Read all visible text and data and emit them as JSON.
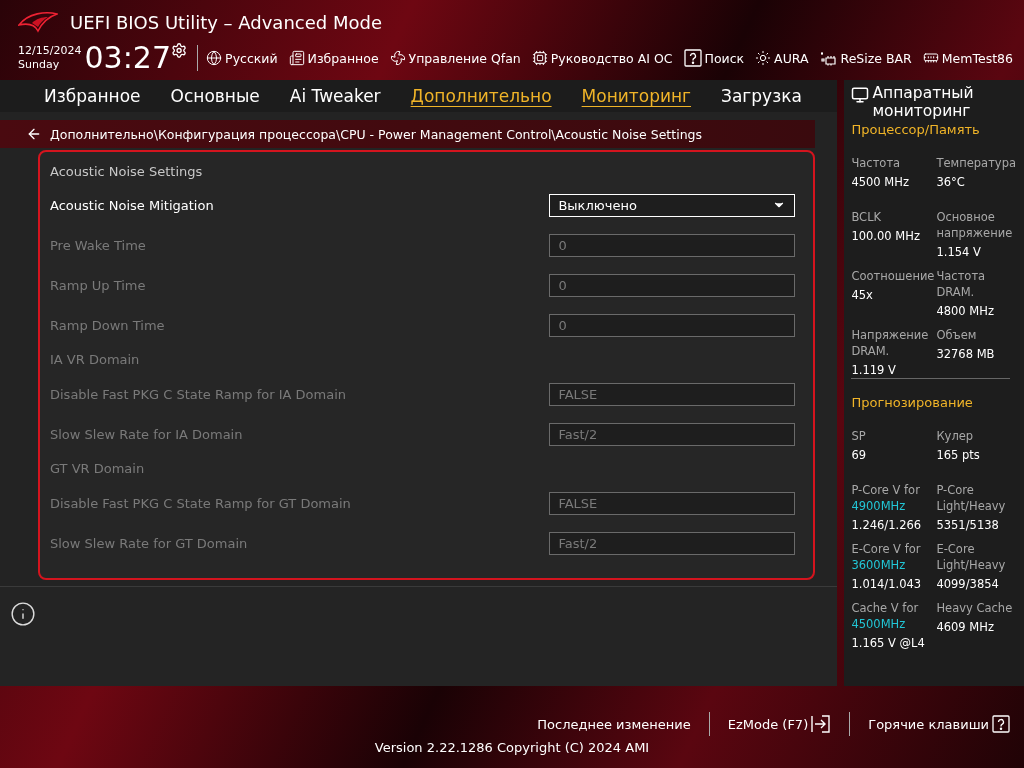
{
  "header": {
    "title": "UEFI BIOS Utility – Advanced Mode",
    "date": "12/15/2024",
    "day": "Sunday",
    "time": "03:27",
    "toolbar": [
      {
        "label": "Русский"
      },
      {
        "label": "Избранное"
      },
      {
        "label": "Управление Qfan"
      },
      {
        "label": "Руководство AI OC"
      },
      {
        "label": "Поиск"
      },
      {
        "label": "AURA"
      },
      {
        "label": "ReSize BAR"
      },
      {
        "label": "MemTest86"
      }
    ]
  },
  "tabs": [
    {
      "label": "Избранное",
      "highlighted": false
    },
    {
      "label": "Основные",
      "highlighted": false
    },
    {
      "label": "Ai Tweaker",
      "highlighted": false
    },
    {
      "label": "Дополнительно",
      "highlighted": true
    },
    {
      "label": "Мониторинг",
      "highlighted": true
    },
    {
      "label": "Загрузка",
      "highlighted": false
    }
  ],
  "breadcrumb": "Дополнительно\\Конфигурация процессора\\CPU - Power Management Control\\Acoustic Noise Settings",
  "settings": {
    "title": "Acoustic Noise Settings",
    "rows": [
      {
        "kind": "dropdown",
        "label": "Acoustic Noise Mitigation",
        "value": "Выключено",
        "disabled": false
      },
      {
        "kind": "field",
        "label": "Pre Wake Time",
        "value": "0",
        "disabled": true
      },
      {
        "kind": "field",
        "label": "Ramp Up Time",
        "value": "0",
        "disabled": true
      },
      {
        "kind": "field",
        "label": "Ramp Down Time",
        "value": "0",
        "disabled": true
      },
      {
        "kind": "group",
        "label": "IA VR Domain"
      },
      {
        "kind": "field",
        "label": "Disable Fast PKG C State Ramp for IA Domain",
        "value": "FALSE",
        "disabled": true
      },
      {
        "kind": "field",
        "label": "Slow Slew Rate for IA Domain",
        "value": "Fast/2",
        "disabled": true
      },
      {
        "kind": "group",
        "label": "GT VR Domain"
      },
      {
        "kind": "field",
        "label": "Disable Fast PKG C State Ramp for GT Domain",
        "value": "FALSE",
        "disabled": true
      },
      {
        "kind": "field",
        "label": "Slow Slew Rate for GT Domain",
        "value": "Fast/2",
        "disabled": true
      }
    ]
  },
  "monitor": {
    "title": "Аппаратный мониторинг",
    "sections": [
      {
        "title": "Процессор/Память",
        "items": [
          {
            "label": "Частота",
            "value": "4500 MHz"
          },
          {
            "label": "Температура",
            "value": "36°C"
          },
          {
            "label": "BCLK",
            "value": "100.00 MHz"
          },
          {
            "label": "Основное напряжение",
            "value": "1.154 V"
          },
          {
            "label": "Соотношение",
            "value": "45x"
          },
          {
            "label": "Частота DRAM.",
            "value": "4800 MHz"
          },
          {
            "label": "Напряжение DRAM.",
            "value": "1.119 V"
          },
          {
            "label": "Объем",
            "value": "32768 MB"
          }
        ]
      },
      {
        "title": "Прогнозирование",
        "items": [
          {
            "label": "SP",
            "value": "69"
          },
          {
            "label": "Кулер",
            "value": "165 pts"
          },
          {
            "label": "P-Core V for",
            "label_highlight": "4900MHz",
            "value": "1.246/1.266"
          },
          {
            "label": "P-Core Light/Heavy",
            "value": "5351/5138"
          },
          {
            "label": "E-Core V for",
            "label_highlight": "3600MHz",
            "value": "1.014/1.043"
          },
          {
            "label": "E-Core Light/Heavy",
            "value": "4099/3854"
          },
          {
            "label": "Cache V for",
            "label_highlight": "4500MHz",
            "value": "1.165 V @L4"
          },
          {
            "label": "Heavy Cache",
            "value": "4609 MHz"
          }
        ]
      }
    ]
  },
  "footer": {
    "actions": [
      {
        "label": "Последнее изменение"
      },
      {
        "label": "EzMode (F7)"
      },
      {
        "label": "Горячие клавиши"
      }
    ],
    "version": "Version 2.22.1286 Copyright (C) 2024 AMI"
  }
}
